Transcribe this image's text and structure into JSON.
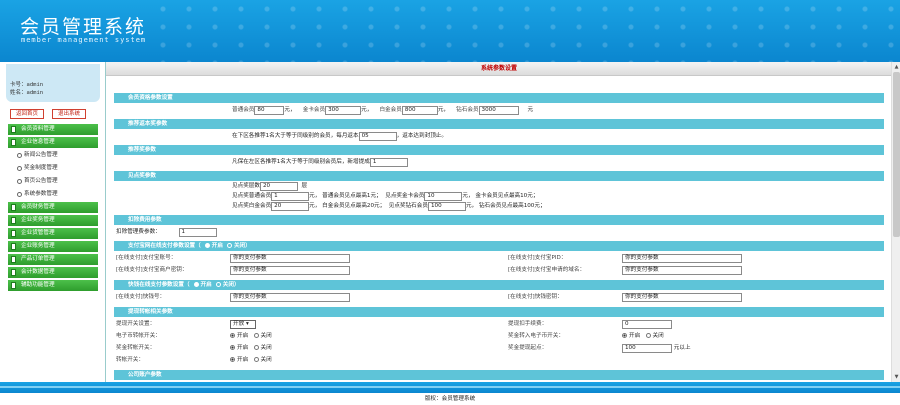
{
  "header": {
    "title": "会员管理系统",
    "subtitle": "member management system"
  },
  "user": {
    "card_label": "卡号：",
    "card_value": "admin",
    "name_label": "姓名：",
    "name_value": "admin"
  },
  "sidebar": {
    "buttons": [
      "返回首页",
      "退出系统"
    ],
    "items": [
      {
        "type": "main",
        "label": "会员资料管理"
      },
      {
        "type": "main",
        "label": "企业信息管理"
      },
      {
        "type": "sub",
        "label": "新闻公告管理"
      },
      {
        "type": "sub",
        "label": "奖金制度管理"
      },
      {
        "type": "sub",
        "label": "首页公告管理"
      },
      {
        "type": "sub",
        "label": "系统参数管理"
      },
      {
        "type": "main",
        "label": "会员财务管理"
      },
      {
        "type": "main",
        "label": "企业奖务管理"
      },
      {
        "type": "main",
        "label": "企业货管管理"
      },
      {
        "type": "main",
        "label": "企业账务管理"
      },
      {
        "type": "main",
        "label": "产品订单管理"
      },
      {
        "type": "main",
        "label": "会计数据管理"
      },
      {
        "type": "main",
        "label": "辅助功能管理"
      }
    ]
  },
  "main": {
    "title": "系统参数设置",
    "sections": {
      "fee": {
        "title": "会员资格参数设置",
        "label1": "普通会员",
        "val1": "80",
        "unit1": "元，",
        "label2": "金卡会员",
        "val2": "300",
        "unit2": "元，",
        "label3": "白金会员",
        "val3": "800",
        "unit3": "元，",
        "label4": "钻石会员",
        "val4": "3000",
        "unit4": "元"
      },
      "recommend": {
        "title": "推荐返本奖参数",
        "text1": "在下区各推荐1名大于等于同级别的会员，每月返本",
        "val": "05",
        "text2": "，返本达到封顶止。"
      },
      "recommend2": {
        "title": "推荐奖参数",
        "text1": "凡保在左区各推荐1名大于等于同级别会员后，新增提成",
        "val": "1"
      },
      "points": {
        "title": "见点奖参数",
        "line1_label": "见点奖层数",
        "line1_val": "20",
        "line1_unit": "层",
        "line2_a": "见点奖普通会员",
        "line2_a_val": "1",
        "line2_a_unit": "元，",
        "line2_b": "普通会员见点最高1元；",
        "line2_c": "见点奖金卡会员",
        "line2_c_val": "10",
        "line2_c_unit": "元，",
        "line2_d": "金卡会员见点最高10元；",
        "line3_a": "见点奖白金会员",
        "line3_a_val": "20",
        "line3_a_unit": "元，",
        "line3_b": "白金会员见点最高20元；",
        "line3_c": "见点奖钻石会员",
        "line3_c_val": "100",
        "line3_c_unit": "元，",
        "line3_d": "钻石会员见点最高100元；"
      },
      "deduct": {
        "title": "扣除费用参数",
        "label": "扣除管理费参数：",
        "val": "1"
      },
      "alipay": {
        "title": "支付宝网在线支付参数设置（",
        "on": "开启",
        "off": "关闭",
        "close_paren": "）",
        "f1_label": "[在线支付]支付宝账号：",
        "f1_val": "你的支付参数",
        "f2_label": "[在线支付]支付宝PID：",
        "f2_val": "你的支付参数",
        "f3_label": "[在线支付]支付宝商户密钥：",
        "f3_val": "你的支付参数",
        "f4_label": "[在线支付]支付宝申请的域名：",
        "f4_val": "你的支付参数"
      },
      "kuaiqian": {
        "title": "快钱在线支付参数设置（",
        "on": "开启",
        "off": "关闭",
        "close_paren": "）",
        "f1_label": "[在线支付]快钱号：",
        "f1_val": "你的支付参数",
        "f2_label": "[在线支付]快钱密钥：",
        "f2_val": "你的支付参数"
      },
      "withdraw": {
        "title": "提现转帐相关参数",
        "r1_label": "提现开关设置：",
        "r1_select": "开放",
        "r1_right_label": "提现扣手续费：",
        "r1_right_val": "0",
        "r2_label": "电子币转帐开关：",
        "r2_right_label": "奖金转入电子币开关：",
        "r3_label": "奖金转帐开关：",
        "r3_right_label": "奖金提现起点：",
        "r3_right_val": "100",
        "r3_right_unit": "元以上",
        "r4_label": "转帐开关：",
        "on": "开启",
        "off": "关闭"
      },
      "next": {
        "title": "公司账户参数"
      }
    }
  },
  "footer": {
    "text": "版权：会员管理系统"
  },
  "colors": {
    "header": "#0b86cf",
    "section": "#5ec4d8",
    "menu": "#2e9d2d",
    "title": "#c00000"
  }
}
